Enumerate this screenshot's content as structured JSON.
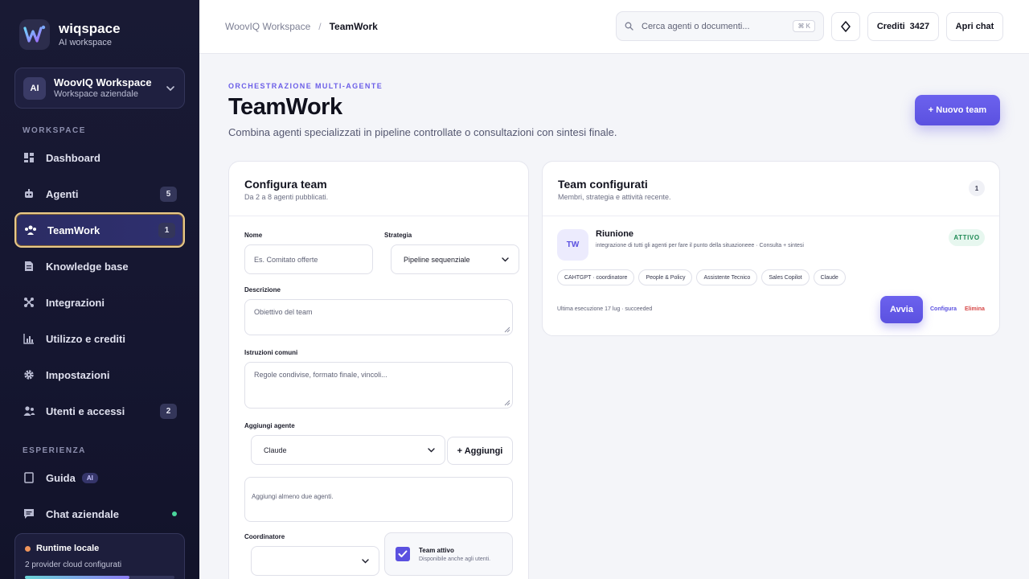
{
  "sidebar": {
    "brand": {
      "name": "wiqspace",
      "subtitle": "AI workspace"
    },
    "workspace": {
      "avatar": "AI",
      "name": "WoovIQ Workspace",
      "subtitle": "Workspace aziendale"
    },
    "section_workspace": "WORKSPACE",
    "section_experience": "ESPERIENZA",
    "nav": [
      {
        "label": "Dashboard",
        "icon": "dashboard-icon"
      },
      {
        "label": "Agenti",
        "icon": "robot-icon",
        "badge": "5"
      },
      {
        "label": "TeamWork",
        "icon": "team-icon",
        "badge": "1",
        "active": true
      },
      {
        "label": "Knowledge base",
        "icon": "document-icon"
      },
      {
        "label": "Integrazioni",
        "icon": "integrations-icon"
      },
      {
        "label": "Utilizzo e crediti",
        "icon": "chart-icon"
      },
      {
        "label": "Impostazioni",
        "icon": "gear-icon"
      },
      {
        "label": "Utenti e accessi",
        "icon": "users-icon",
        "badge": "2"
      }
    ],
    "experience": [
      {
        "label": "Guida",
        "icon": "book-icon",
        "tag": "AI"
      },
      {
        "label": "Chat aziendale",
        "icon": "chat-icon",
        "online": true
      }
    ],
    "runtime": {
      "title": "Runtime locale",
      "subtitle": "2 provider cloud configurati",
      "progress_pct": 70
    }
  },
  "topbar": {
    "breadcrumb_root": "WoovIQ Workspace",
    "breadcrumb_sep": "/",
    "breadcrumb_current": "TeamWork",
    "search_placeholder": "Cerca agenti o documenti...",
    "search_shortcut": "⌘ K",
    "credits_label": "Crediti",
    "credits_value": "3427",
    "open_chat": "Apri chat"
  },
  "page": {
    "eyebrow": "ORCHESTRAZIONE MULTI-AGENTE",
    "title": "TeamWork",
    "subtitle": "Combina agenti specializzati in pipeline controllate o consultazioni con sintesi finale.",
    "new_team": "+ Nuovo team"
  },
  "form": {
    "title": "Configura team",
    "subtitle": "Da 2 a 8 agenti pubblicati.",
    "name_label": "Nome",
    "name_placeholder": "Es. Comitato offerte",
    "strategy_label": "Strategia",
    "strategy_value": "Pipeline sequenziale",
    "description_label": "Descrizione",
    "description_placeholder": "Obiettivo del team",
    "instructions_label": "Istruzioni comuni",
    "instructions_placeholder": "Regole condivise, formato finale, vincoli...",
    "add_agent_label": "Aggiungi agente",
    "add_agent_value": "Claude",
    "add_button": "+ Aggiungi",
    "agents_placeholder": "Aggiungi almeno due agenti.",
    "coordinator_label": "Coordinatore",
    "coordinator_value": "",
    "active_title": "Team attivo",
    "active_subtitle": "Disponibile anche agli utenti."
  },
  "teams": {
    "title": "Team configurati",
    "subtitle": "Membri, strategia e attività recente.",
    "count": "1",
    "items": [
      {
        "avatar": "TW",
        "name": "Riunione",
        "description": "integrazione di tutti gli agenti per fare il punto della situazioneee · Consulta + sintesi",
        "status": "ATTIVO",
        "members": [
          "CAHTGPT · coordinatore",
          "People & Policy",
          "Assistente Tecnico",
          "Sales Copilot",
          "Claude"
        ],
        "last_run": "Ultima esecuzione 17 lug · succeeded",
        "run_button": "Avvia",
        "configure": "Configura",
        "delete": "Elimina"
      }
    ]
  },
  "colors": {
    "accent": "#5b51e0",
    "sidebar_bg": "#191a34",
    "active_border": "#e8c98a",
    "success": "#1f8a55",
    "danger": "#d64545"
  }
}
